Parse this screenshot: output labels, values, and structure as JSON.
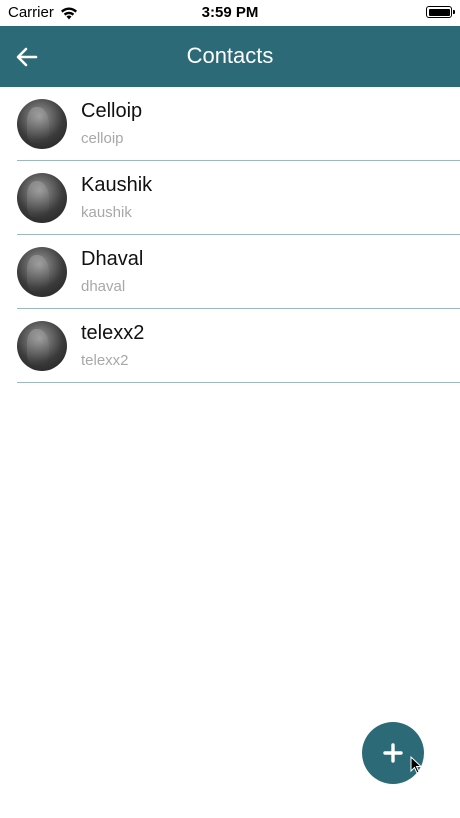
{
  "status_bar": {
    "carrier": "Carrier",
    "time": "3:59 PM"
  },
  "header": {
    "title": "Contacts"
  },
  "contacts": [
    {
      "name": "Celloip",
      "username": "celloip"
    },
    {
      "name": "Kaushik",
      "username": "kaushik"
    },
    {
      "name": "Dhaval",
      "username": "dhaval"
    },
    {
      "name": "telexx2",
      "username": "telexx2"
    }
  ],
  "colors": {
    "primary": "#2c6a78",
    "divider": "#9bb8be",
    "secondary_text": "#a8a8a8"
  }
}
